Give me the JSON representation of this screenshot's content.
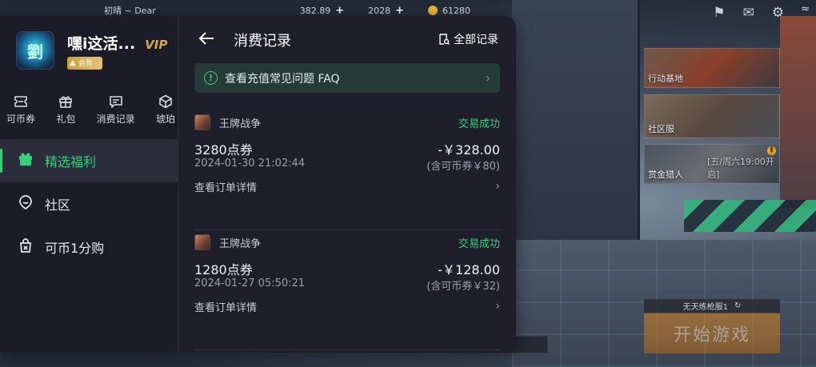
{
  "game_hud": {
    "player_name": "初晴 ~ Dear",
    "resource_1": "382.89",
    "resource_2": "2028",
    "resource_3": "61280",
    "menu_cards": [
      "行动基地",
      "社区服",
      "赏金猎人"
    ],
    "card_3_sub": "[五/周六19:00开启]",
    "loadout_label": "无天练枪服1",
    "start_button": "开始游戏"
  },
  "profile": {
    "name": "嘿i这活...",
    "vip": "VIP",
    "member_badge": "会员",
    "avatar_text": "劉"
  },
  "shortcuts": [
    {
      "label": "可币券",
      "icon": "ticket-icon"
    },
    {
      "label": "礼包",
      "icon": "gift-icon"
    },
    {
      "label": "消费记录",
      "icon": "receipt-icon"
    },
    {
      "label": "琥珀",
      "icon": "gem-icon"
    }
  ],
  "nav": [
    {
      "label": "精选福利",
      "icon": "gift-icon",
      "active": true
    },
    {
      "label": "社区",
      "icon": "community-icon",
      "active": false
    },
    {
      "label": "可币1分购",
      "icon": "shopping-bag-icon",
      "active": false
    }
  ],
  "main": {
    "title": "消费记录",
    "all_records": "全部记录",
    "faq": "查看充值常见问题 FAQ",
    "records": [
      {
        "game": "王牌战争",
        "status": "交易成功",
        "item": "3280点券",
        "amount": "-￥328.00",
        "time": "2024-01-30 21:02:44",
        "coupon": "(含可币券￥80)",
        "detail": "查看订单详情"
      },
      {
        "game": "王牌战争",
        "status": "交易成功",
        "item": "1280点券",
        "amount": "-￥128.00",
        "time": "2024-01-27 05:50:21",
        "coupon": "(含可币券￥32)",
        "detail": "查看订单详情"
      }
    ]
  },
  "colors": {
    "accent_green": "#36d07c",
    "panel_bg": "#1e1f2b",
    "faq_bg": "#263a37",
    "vip_gold": "#d6a84a"
  }
}
